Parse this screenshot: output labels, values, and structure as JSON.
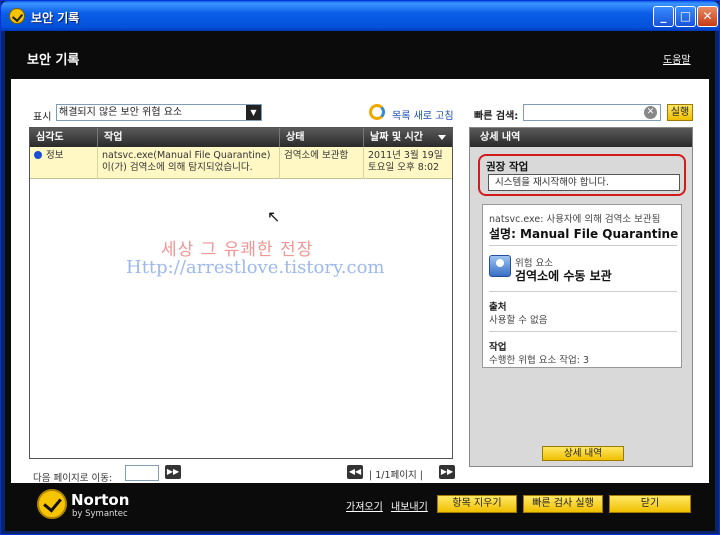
{
  "window": {
    "title": "보안 기록"
  },
  "header": {
    "title": "보안 기록",
    "help": "도움말"
  },
  "toolbar": {
    "filter_label": "표시",
    "filter_value": "해결되지 않은 보안 위협 요소",
    "refresh": "목록 새로 고침",
    "search_label": "빠른 검색:",
    "search_value": "",
    "search_go": "실행"
  },
  "table": {
    "headers": [
      "심각도",
      "작업",
      "상태",
      "날짜 및 시간"
    ],
    "rows": [
      {
        "severity": "정보",
        "task": "natsvc.exe(Manual File Quarantine)이(가) 검역소에 의해 탐지되었습니다.",
        "status": "검역소에 보관함",
        "datetime": "2011년 3월 19일 토요일 오후 8:02"
      }
    ]
  },
  "watermark": {
    "line1": "세상 그 유쾌한 전장",
    "line2": "Http://arrestlove.tistory.com"
  },
  "pager": {
    "label": "다음 페이지로 이동:",
    "info": "| 1/1페이지 |"
  },
  "details": {
    "header": "상세 내역",
    "recommended_title": "권장 작업",
    "recommended_text": "시스템을 재시작해야 합니다.",
    "summary_line1": "natsvc.exe: 사용자에 의해 검역소 보관됨",
    "summary_line2": "설명: Manual File Quarantine",
    "threat_label": "위험 요소",
    "threat_value": "검역소에 수동 보관",
    "source_label": "출처",
    "source_value": "사용할 수 없음",
    "action_label": "작업",
    "action_value": "수행한 위협 요소 작업: 3",
    "button": "상세 내역"
  },
  "footer": {
    "brand": "Norton",
    "brand_sub": "by Symantec",
    "import": "가져오기",
    "export": "내보내기",
    "clear_btn": "항목 지우기",
    "quick_scan_btn": "빠른 검사 실행",
    "close_btn": "닫기"
  }
}
